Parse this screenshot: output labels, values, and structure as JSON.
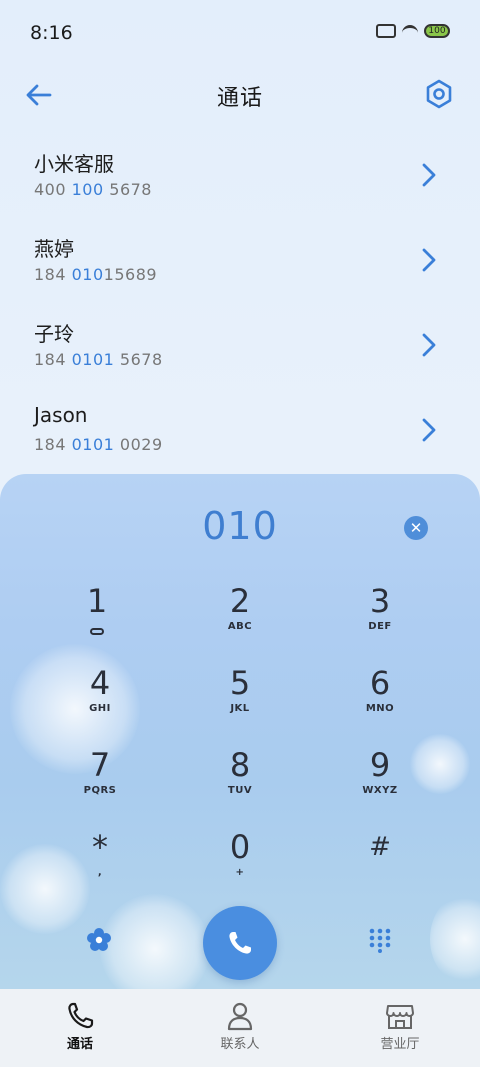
{
  "status": {
    "time": "8:16",
    "battery": "100"
  },
  "header": {
    "title": "通话"
  },
  "contacts": [
    {
      "name": "小米客服",
      "num_pre": "400 ",
      "num_hl": "100",
      "num_post": " 5678"
    },
    {
      "name": "燕婷",
      "num_pre": "184 ",
      "num_hl": "010",
      "num_post": "15689"
    },
    {
      "name": "子玲",
      "num_pre": "184 ",
      "num_hl": "0101",
      "num_post": " 5678"
    },
    {
      "name": "Jason",
      "num_pre": "184 ",
      "num_hl": "0101",
      "num_post": " 0029"
    }
  ],
  "dialpad": {
    "display": "010",
    "keys": [
      {
        "digit": "1",
        "letters": ""
      },
      {
        "digit": "2",
        "letters": "ABC"
      },
      {
        "digit": "3",
        "letters": "DEF"
      },
      {
        "digit": "4",
        "letters": "GHI"
      },
      {
        "digit": "5",
        "letters": "JKL"
      },
      {
        "digit": "6",
        "letters": "MNO"
      },
      {
        "digit": "7",
        "letters": "PQRS"
      },
      {
        "digit": "8",
        "letters": "TUV"
      },
      {
        "digit": "9",
        "letters": "WXYZ"
      },
      {
        "digit": "*",
        "letters": ","
      },
      {
        "digit": "0",
        "letters": "+"
      },
      {
        "digit": "#",
        "letters": ""
      }
    ]
  },
  "nav": [
    {
      "label": "通话"
    },
    {
      "label": "联系人"
    },
    {
      "label": "营业厅"
    }
  ],
  "colors": {
    "accent": "#4a8ee0",
    "highlight": "#3a7fd8"
  }
}
